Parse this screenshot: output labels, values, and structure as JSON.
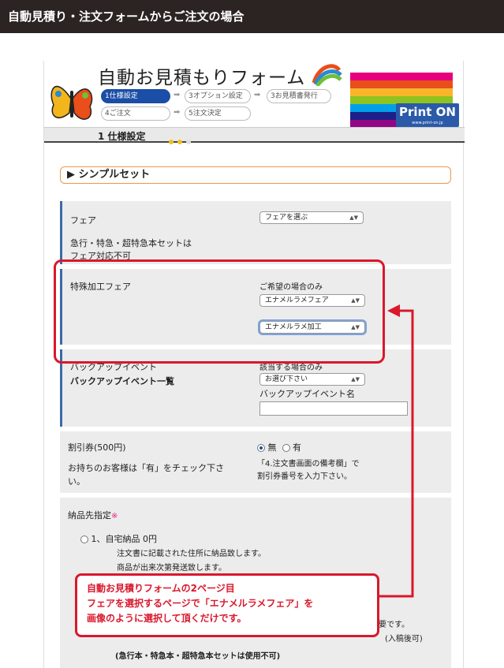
{
  "page": {
    "heading": "自動見積り・注文フォームからご注文の場合"
  },
  "header": {
    "title": "自動お見積もりフォーム",
    "steps": [
      "1仕様設定",
      "3オプション設定",
      "3お見積書発行",
      "4ご注文",
      "5注文決定"
    ],
    "brand": "Print ON",
    "brand_url": "www.print-on.jp",
    "stepbar_label": "1 仕様設定"
  },
  "section": {
    "title": "シンプルセット"
  },
  "fair": {
    "label": "フェア",
    "note": "急行・特急・超特急本セットは\nフェア対応不可",
    "select": "フェアを選ぶ"
  },
  "special_fair": {
    "label": "特殊加工フェア",
    "hint": "ご希望の場合のみ",
    "select1": "エナメルラメフェア",
    "select2": "エナメルラメ加工"
  },
  "backup": {
    "label": "バックアップイベント",
    "link": "バックアップイベント一覧",
    "hint": "該当する場合のみ",
    "select": "お選び下さい",
    "name_label": "バックアップイベント名",
    "name_value": ""
  },
  "coupon": {
    "label": "割引券(500円)",
    "note": "お持ちのお客様は「有」をチェック下さい。",
    "opt_no": "無",
    "opt_yes": "有",
    "instr1": "「4.注文書画面の備考欄」で",
    "instr2": "割引券番号を入力下さい。"
  },
  "delivery": {
    "label": "納品先指定",
    "required": "※",
    "opt1": "1、自宅納品 0円",
    "desc1": "注文書に記載された住所に納品致します。",
    "desc2": "商品が出来次第発送致します。",
    "frag1": "要です。",
    "frag2": "(入稿後可)",
    "note": "(急行本・特急本・超特急本セットは使用不可)"
  },
  "callout": {
    "line1": "自動お見積りフォームの2ページ目",
    "line2": "フェアを選択するページで「エナメルラメフェア」を",
    "line3": "画像のように選択して頂くだけです。"
  },
  "colors": {
    "accent": "#d9182c",
    "brand": "#1b4ea6",
    "pink": "#e4287a"
  }
}
